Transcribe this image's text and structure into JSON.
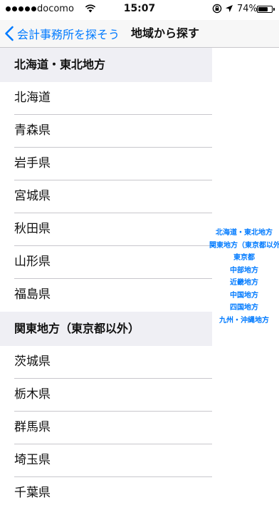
{
  "status_bar": {
    "carrier": "docomo",
    "time": "15:07",
    "battery_percent": "74%",
    "battery_level": 0.74,
    "signal_dots": 5,
    "icons": [
      "wifi-icon",
      "orientation-lock-icon",
      "location-arrow-icon",
      "battery-icon"
    ]
  },
  "nav": {
    "back_label": "会計事務所を探そう",
    "title": "地域から探す",
    "accent_color": "#007aff"
  },
  "sections": [
    {
      "header": "北海道・東北地方",
      "rows": [
        "北海道",
        "青森県",
        "岩手県",
        "宮城県",
        "秋田県",
        "山形県",
        "福島県"
      ]
    },
    {
      "header": "関東地方（東京都以外）",
      "rows": [
        "茨城県",
        "栃木県",
        "群馬県",
        "埼玉県",
        "千葉県"
      ]
    }
  ],
  "section_index": [
    "北海道・東北地方",
    "関東地方（東京都以外）",
    "東京都",
    "中部地方",
    "近畿地方",
    "中国地方",
    "四国地方",
    "九州・沖縄地方"
  ]
}
